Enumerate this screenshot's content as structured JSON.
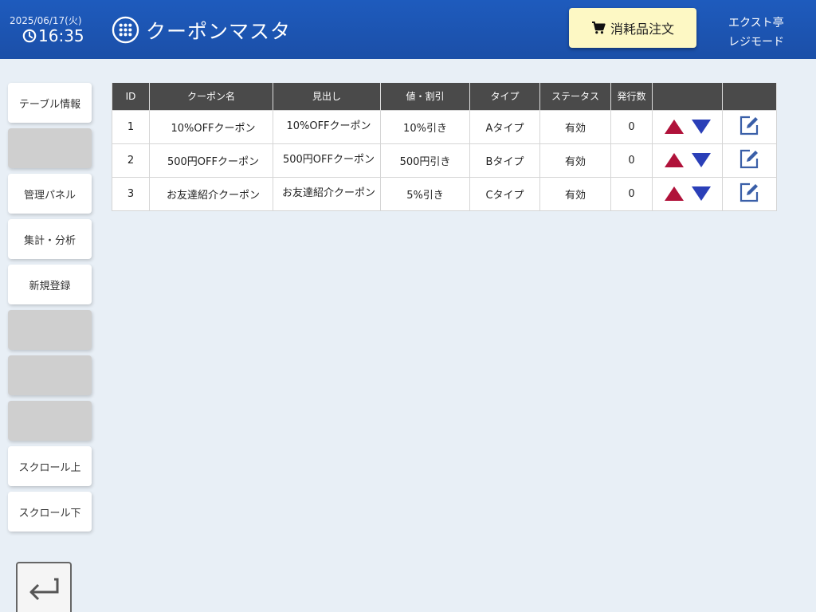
{
  "header": {
    "date": "2025/06/17(火)",
    "time": "16:35",
    "title": "クーポンマスタ",
    "order_button": "消耗品注文",
    "store_name": "エクスト亭",
    "mode": "レジモード"
  },
  "sidebar": {
    "items": [
      {
        "label": "テーブル情報"
      },
      {
        "label": ""
      },
      {
        "label": "管理パネル"
      },
      {
        "label": "集計・分析"
      },
      {
        "label": "新規登録"
      },
      {
        "label": ""
      },
      {
        "label": ""
      },
      {
        "label": ""
      },
      {
        "label": "スクロール上"
      },
      {
        "label": "スクロール下"
      }
    ]
  },
  "table": {
    "columns": [
      "ID",
      "クーポン名",
      "見出し",
      "値・割引",
      "タイプ",
      "ステータス",
      "発行数",
      "",
      ""
    ],
    "rows": [
      {
        "id": "1",
        "name": "10%OFFクーポン",
        "heading": "10%OFFクーポン",
        "value": "10%引き",
        "type": "Aタイプ",
        "status": "有効",
        "count": "0"
      },
      {
        "id": "2",
        "name": "500円OFFクーポン",
        "heading": "500円OFFクーポン",
        "value": "500円引き",
        "type": "Bタイプ",
        "status": "有効",
        "count": "0"
      },
      {
        "id": "3",
        "name": "お友達紹介クーポン",
        "heading": "お友達紹介クーポン",
        "value": "5%引き",
        "type": "Cタイプ",
        "status": "有効",
        "count": "0"
      }
    ]
  },
  "icons": {
    "clock": "clock-icon",
    "grid": "grid-menu-icon",
    "cart": "cart-icon",
    "up": "move-up-icon",
    "down": "move-down-icon",
    "edit": "edit-icon",
    "back": "back-icon"
  },
  "colors": {
    "header": "#1e5bbd",
    "order_button": "#fdf8c4",
    "up_arrow": "#b0123a",
    "down_arrow": "#2a3fb8",
    "edit": "#3a5fa8"
  }
}
